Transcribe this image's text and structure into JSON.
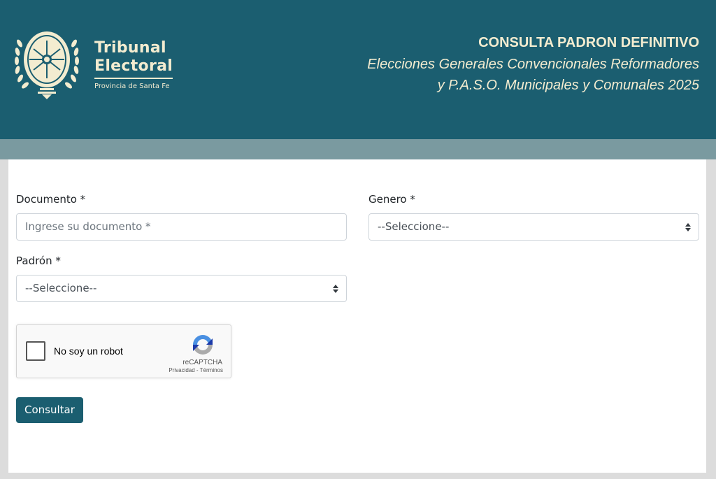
{
  "header": {
    "logo_title_line1": "Tribunal",
    "logo_title_line2": "Electoral",
    "logo_subtitle": "Provincia de Santa Fe",
    "title": "CONSULTA PADRON DEFINITIVO",
    "subtitle_line1": "Elecciones Generales Convencionales Reformadores",
    "subtitle_line2": "y P.A.S.O. Municipales y Comunales 2025"
  },
  "form": {
    "documento_label": "Documento *",
    "documento_placeholder": "Ingrese su documento *",
    "documento_value": "",
    "genero_label": "Genero *",
    "genero_selected": "--Seleccione--",
    "padron_label": "Padrón *",
    "padron_selected": "--Seleccione--"
  },
  "recaptcha": {
    "label": "No soy un robot",
    "brand": "reCAPTCHA",
    "links": "Privacidad - Términos"
  },
  "actions": {
    "submit_label": "Consultar"
  },
  "colors": {
    "primary": "#1b5e70",
    "subbar": "#7a9aa0",
    "header_text": "#f3ecd0"
  }
}
